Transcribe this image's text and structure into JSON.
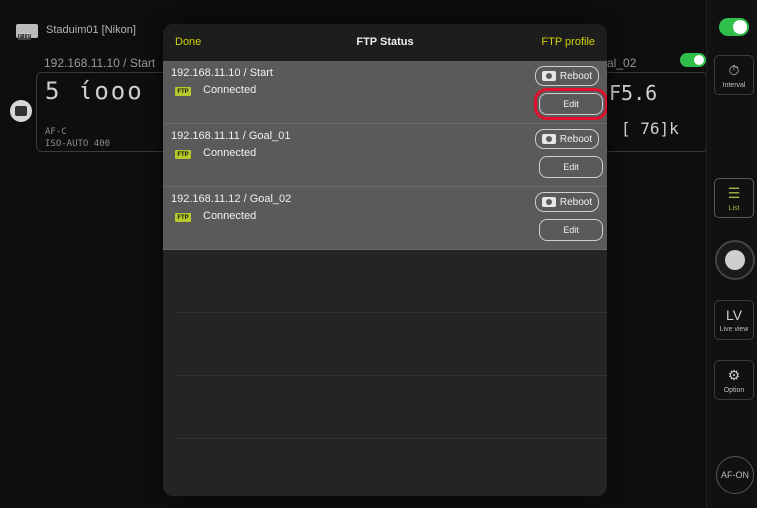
{
  "background": {
    "window_title": "Staduim01 [Nikon]",
    "left_camera_label": "192.168.11.10 / Start",
    "right_camera_label": "al_02",
    "left_display_main": "5  ίοοο",
    "left_display_sub": "AF-C",
    "left_iso": "ISO-AUTO 400",
    "right_display_main": "F5.6",
    "right_display_sub": "[ 76]k",
    "afc_label": "AF-C"
  },
  "sidebar": {
    "interval_label": "Interval",
    "list_label": "List",
    "liveview_top": "LV",
    "liveview_label": "Live view",
    "option_label": "Option",
    "afon_label": "AF-ON"
  },
  "modal": {
    "done_label": "Done",
    "title": "FTP Status",
    "profile_label": "FTP profile",
    "rows": [
      {
        "ip_label": "192.168.11.10 / Start",
        "ftp_badge": "FTP",
        "status": "Connected",
        "reboot_label": "Reboot",
        "edit_label": "Edit"
      },
      {
        "ip_label": "192.168.11.11 / Goal_01",
        "ftp_badge": "FTP",
        "status": "Connected",
        "reboot_label": "Reboot",
        "edit_label": "Edit"
      },
      {
        "ip_label": "192.168.11.12 / Goal_02",
        "ftp_badge": "FTP",
        "status": "Connected",
        "reboot_label": "Reboot",
        "edit_label": "Edit"
      }
    ]
  },
  "colors": {
    "accent_yellow": "#d0d000",
    "ftp_badge": "#b6c82b",
    "toggle_on": "#2fbf4a",
    "highlight": "#e1102a"
  }
}
